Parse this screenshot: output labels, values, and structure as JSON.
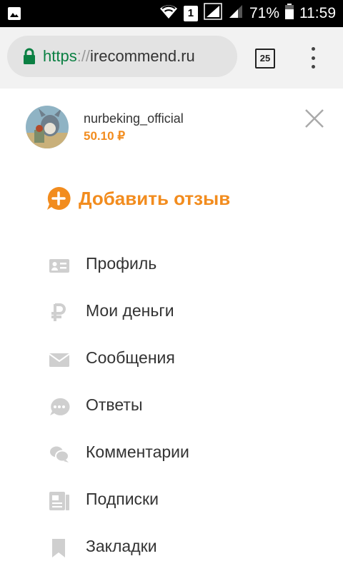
{
  "status_bar": {
    "sim_slot": "1",
    "battery_percent": "71%",
    "time": "11:59"
  },
  "browser": {
    "url_scheme": "https",
    "url_separator": "://",
    "url_host": "irecommend.ru",
    "tab_count": "25"
  },
  "user": {
    "username": "nurbeking_official",
    "balance": "50.10 ₽"
  },
  "add_review": {
    "label": "Добавить отзыв"
  },
  "menu": [
    {
      "label": "Профиль",
      "icon": "profile-card-icon"
    },
    {
      "label": "Мои деньги",
      "icon": "ruble-icon"
    },
    {
      "label": "Сообщения",
      "icon": "envelope-icon"
    },
    {
      "label": "Ответы",
      "icon": "chat-bubble-icon"
    },
    {
      "label": "Комментарии",
      "icon": "comments-icon"
    },
    {
      "label": "Подписки",
      "icon": "subscriptions-icon"
    },
    {
      "label": "Закладки",
      "icon": "bookmark-icon"
    }
  ],
  "colors": {
    "accent": "#f28c1e",
    "icon_gray": "#cfcfcf",
    "text": "#333333",
    "url_green": "#0b8043"
  }
}
